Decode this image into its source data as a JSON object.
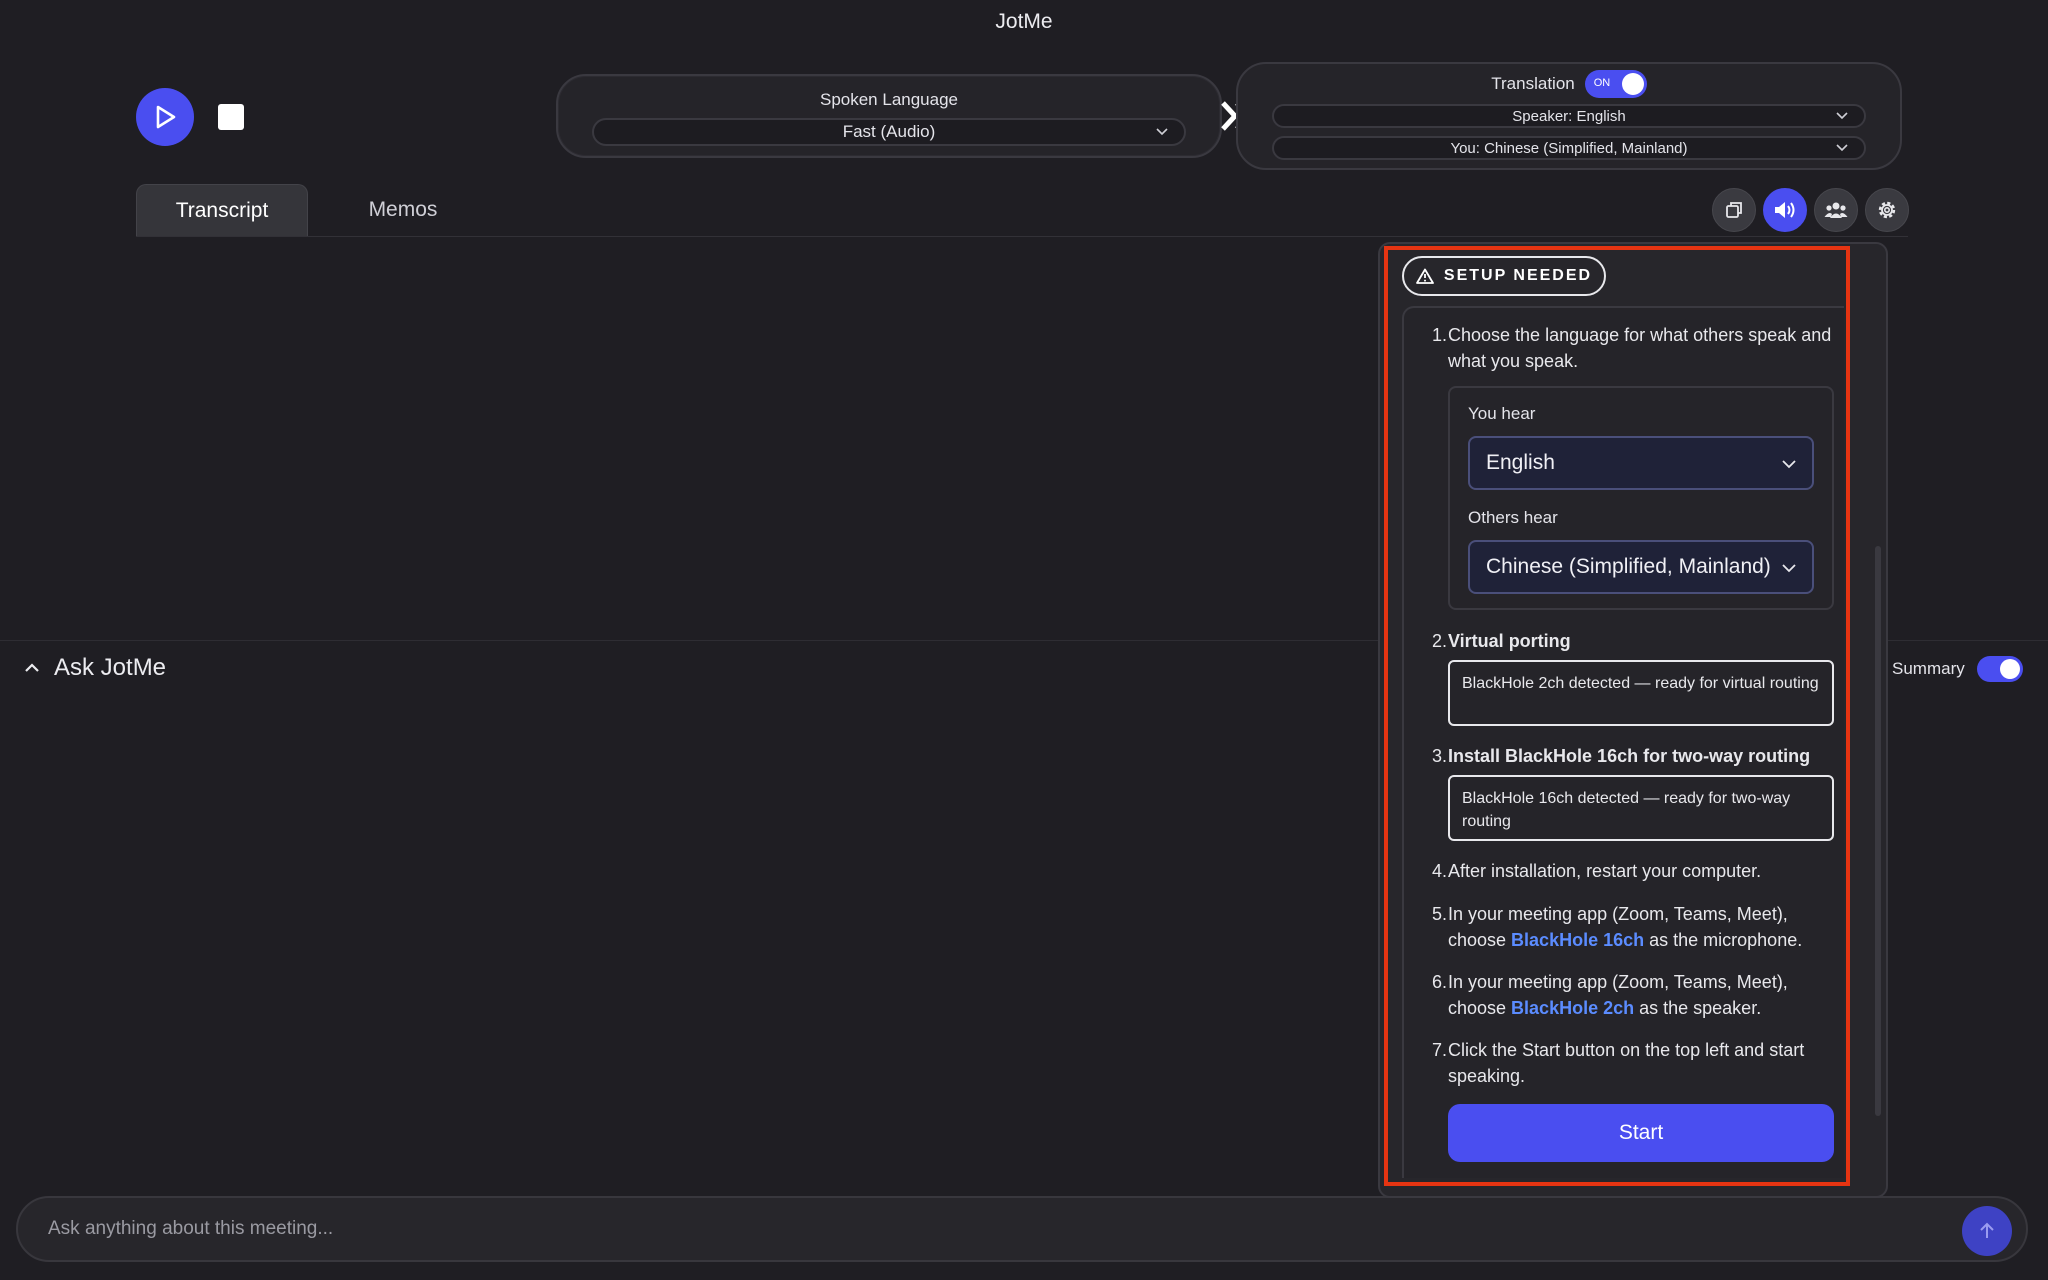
{
  "app": {
    "title": "JotMe"
  },
  "controls": {
    "play_icon": "play-icon",
    "stop_icon": "stop-icon"
  },
  "spoken_language": {
    "title": "Spoken Language",
    "selected": "Fast (Audio)"
  },
  "translation": {
    "label": "Translation",
    "toggle_text": "ON",
    "speaker": "Speaker: English",
    "you": "You: Chinese (Simplified, Mainland)"
  },
  "tabs": [
    {
      "label": "Transcript",
      "active": true
    },
    {
      "label": "Memos",
      "active": false
    }
  ],
  "toolbar_icons": [
    "copy-icon",
    "speaker-icon",
    "users-icon",
    "gear-icon"
  ],
  "ask": {
    "title": "Ask JotMe",
    "summary_label": "Summary",
    "placeholder": "Ask anything about this meeting..."
  },
  "setup": {
    "badge": "SETUP NEEDED",
    "steps": {
      "s1": {
        "num": "1.",
        "text": "Choose the language for what others speak and what you speak."
      },
      "you_hear_label": "You hear",
      "you_hear_value": "English",
      "others_hear_label": "Others hear",
      "others_hear_value": "Chinese (Simplified, Mainland)",
      "s2": {
        "num": "2.",
        "title": "Virtual porting",
        "status": "BlackHole 2ch detected — ready for virtual routing"
      },
      "s3": {
        "num": "3.",
        "title": "Install BlackHole 16ch for two-way routing",
        "status": "BlackHole 16ch detected — ready for two-way routing"
      },
      "s4": {
        "num": "4.",
        "text": "After installation, restart your computer."
      },
      "s5": {
        "num": "5.",
        "pre": "In your meeting app (Zoom, Teams, Meet), choose ",
        "hl": "BlackHole 16ch",
        "post": " as the microphone."
      },
      "s6": {
        "num": "6.",
        "pre": "In your meeting app (Zoom, Teams, Meet), choose ",
        "hl": "BlackHole 2ch",
        "post": " as the speaker."
      },
      "s7": {
        "num": "7.",
        "text": "Click the Start button on the top left and start speaking."
      }
    },
    "start_label": "Start"
  },
  "colors": {
    "accent": "#4a4ef0",
    "highlight_border": "#e63412",
    "link": "#5b8cff",
    "background": "#1f1e23"
  }
}
